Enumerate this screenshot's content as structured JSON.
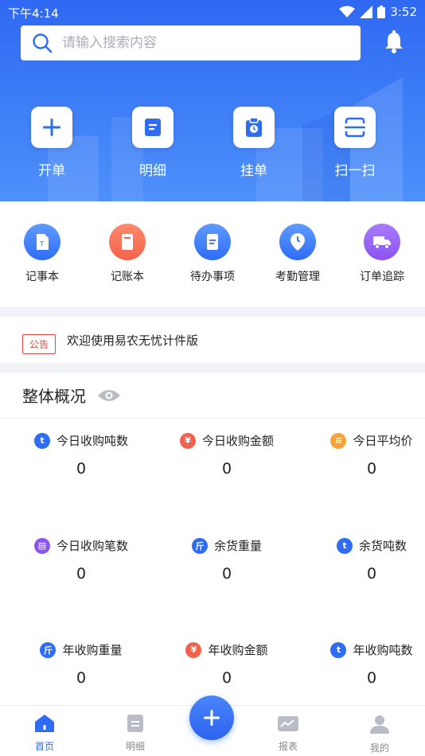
{
  "status": {
    "time": "下午4:14",
    "battery": "3:52"
  },
  "search": {
    "placeholder": "请输入搜索内容"
  },
  "quick_actions": [
    {
      "label": "开单",
      "icon": "plus-icon"
    },
    {
      "label": "明细",
      "icon": "detail-doc-icon"
    },
    {
      "label": "挂单",
      "icon": "clipboard-clock-icon"
    },
    {
      "label": "扫一扫",
      "icon": "scan-icon"
    }
  ],
  "functions": [
    {
      "label": "记事本",
      "icon": "notepad-icon",
      "color": "#3b7bf6"
    },
    {
      "label": "记账本",
      "icon": "ledger-icon",
      "color": "#f2624d"
    },
    {
      "label": "待办事项",
      "icon": "todo-icon",
      "color": "#3b7bf6"
    },
    {
      "label": "考勤管理",
      "icon": "attendance-clock-icon",
      "color": "#3b7bf6"
    },
    {
      "label": "订单追踪",
      "icon": "truck-icon",
      "color": "#8b53f0"
    }
  ],
  "notice": {
    "tag": "公告",
    "text": "欢迎使用易农无忧计件版"
  },
  "overview": {
    "title": "整体概况",
    "stats": [
      {
        "label": "今日收购吨数",
        "value": "0",
        "icon_text": "t",
        "color": "#2e6cf6"
      },
      {
        "label": "今日收购金额",
        "value": "0",
        "icon_text": "¥",
        "color": "#f2624d"
      },
      {
        "label": "今日平均价",
        "value": "0",
        "icon_text": "≡",
        "color": "#f7a23b"
      },
      {
        "label": "今日收购笔数",
        "value": "0",
        "icon_text": "▤",
        "color": "#8b53f0"
      },
      {
        "label": "余货重量",
        "value": "0",
        "icon_text": "斤",
        "color": "#2e6cf6"
      },
      {
        "label": "余货吨数",
        "value": "0",
        "icon_text": "t",
        "color": "#2e6cf6"
      },
      {
        "label": "年收购重量",
        "value": "0",
        "icon_text": "斤",
        "color": "#2e6cf6"
      },
      {
        "label": "年收购金额",
        "value": "0",
        "icon_text": "¥",
        "color": "#f2624d"
      },
      {
        "label": "年收购吨数",
        "value": "0",
        "icon_text": "t",
        "color": "#2e6cf6"
      }
    ]
  },
  "tabs": [
    {
      "label": "首页",
      "icon": "home-icon",
      "active": true
    },
    {
      "label": "明细",
      "icon": "detail-doc-icon",
      "active": false
    },
    {
      "label": "报表",
      "icon": "chart-icon",
      "active": false
    },
    {
      "label": "我的",
      "icon": "user-icon",
      "active": false
    }
  ],
  "colors": {
    "primary": "#2e6cf6",
    "accent_red": "#e0473d"
  }
}
